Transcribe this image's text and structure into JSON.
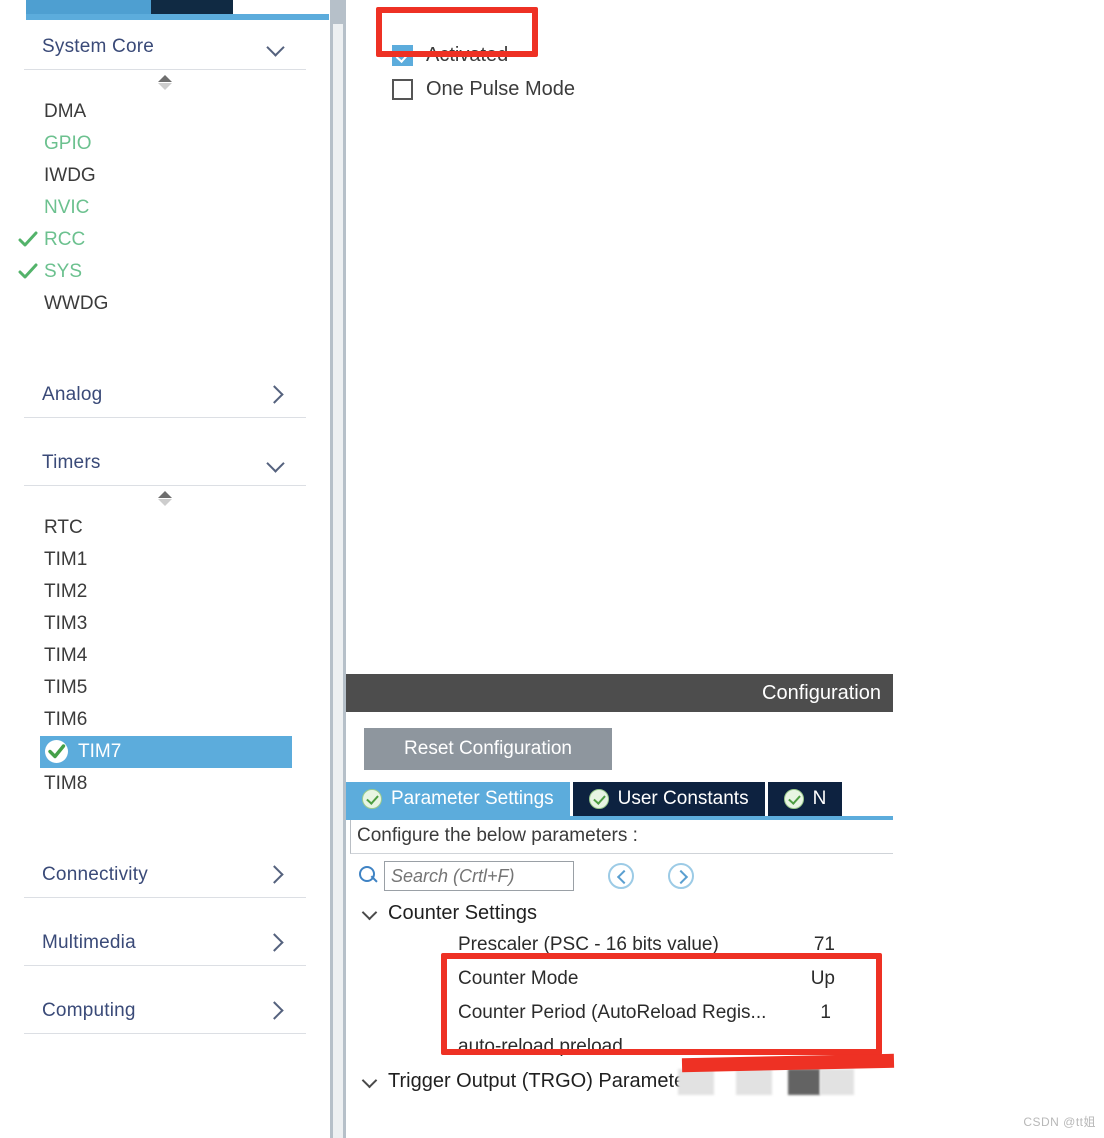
{
  "top_tabs": {
    "tab1_label": "",
    "tab2_label": "",
    "tab3_label": ""
  },
  "sidebar": {
    "sections": [
      {
        "id": "system-core",
        "title": "System Core",
        "expanded": true,
        "chevron": "chevron-down-icon",
        "items": [
          {
            "label": "DMA",
            "state": "plain",
            "checked": false
          },
          {
            "label": "GPIO",
            "state": "green",
            "checked": false
          },
          {
            "label": "IWDG",
            "state": "plain",
            "checked": false
          },
          {
            "label": "NVIC",
            "state": "green",
            "checked": false
          },
          {
            "label": "RCC",
            "state": "green",
            "checked": true
          },
          {
            "label": "SYS",
            "state": "green",
            "checked": true
          },
          {
            "label": "WWDG",
            "state": "plain",
            "checked": false
          }
        ]
      },
      {
        "id": "analog",
        "title": "Analog",
        "expanded": false,
        "chevron": "chevron-right-icon",
        "items": []
      },
      {
        "id": "timers",
        "title": "Timers",
        "expanded": true,
        "chevron": "chevron-down-icon",
        "items": [
          {
            "label": "RTC",
            "state": "plain",
            "checked": false
          },
          {
            "label": "TIM1",
            "state": "plain",
            "checked": false
          },
          {
            "label": "TIM2",
            "state": "plain",
            "checked": false
          },
          {
            "label": "TIM3",
            "state": "plain",
            "checked": false
          },
          {
            "label": "TIM4",
            "state": "plain",
            "checked": false
          },
          {
            "label": "TIM5",
            "state": "plain",
            "checked": false
          },
          {
            "label": "TIM6",
            "state": "plain",
            "checked": false
          },
          {
            "label": "TIM7",
            "state": "selected",
            "checked": true
          },
          {
            "label": "TIM8",
            "state": "plain",
            "checked": false
          }
        ]
      },
      {
        "id": "connectivity",
        "title": "Connectivity",
        "expanded": false,
        "chevron": "chevron-right-icon",
        "items": []
      },
      {
        "id": "multimedia",
        "title": "Multimedia",
        "expanded": false,
        "chevron": "chevron-right-icon",
        "items": []
      },
      {
        "id": "computing",
        "title": "Computing",
        "expanded": false,
        "chevron": "chevron-right-icon",
        "items": []
      }
    ]
  },
  "mode_panel": {
    "checkboxes": [
      {
        "label": "Activated",
        "checked": true,
        "highlighted": true
      },
      {
        "label": "One Pulse Mode",
        "checked": false,
        "highlighted": false
      }
    ]
  },
  "configuration": {
    "header_title": "Configuration",
    "reset_button": "Reset Configuration",
    "tabs": [
      {
        "label": "Parameter Settings",
        "active": true,
        "status_icon": "check-circle-icon"
      },
      {
        "label": "User Constants",
        "active": false,
        "status_icon": "check-circle-icon"
      },
      {
        "label": "N",
        "active": false,
        "status_icon": "check-circle-icon"
      }
    ],
    "note": "Configure the below parameters :",
    "search": {
      "placeholder": "Search (Crtl+F)",
      "value": "",
      "icon": "search-icon",
      "prev_icon": "prev-circle-icon",
      "next_icon": "next-circle-icon"
    },
    "groups": [
      {
        "label": "Counter Settings",
        "expanded": true,
        "rows": [
          {
            "name": "Prescaler (PSC - 16 bits value)",
            "value": "71",
            "highlighted": true
          },
          {
            "name": "Counter Mode",
            "value": "Up",
            "highlighted": true
          },
          {
            "name": "Counter Period (AutoReload Regis...",
            "value": "1",
            "highlighted": true
          },
          {
            "name": "auto-reload preload",
            "value": "",
            "highlighted": false
          }
        ]
      },
      {
        "label": "Trigger Output (TRGO) Parameters",
        "expanded": true,
        "rows": []
      }
    ]
  },
  "watermark": "CSDN @tt姐",
  "colors": {
    "accent_blue": "#5cacdc",
    "tab_dark": "#0d2240",
    "highlight_red": "#ee3124",
    "header_gray": "#4d4d4d",
    "section_title": "#3a4a78",
    "green_text": "#6cc18f"
  }
}
